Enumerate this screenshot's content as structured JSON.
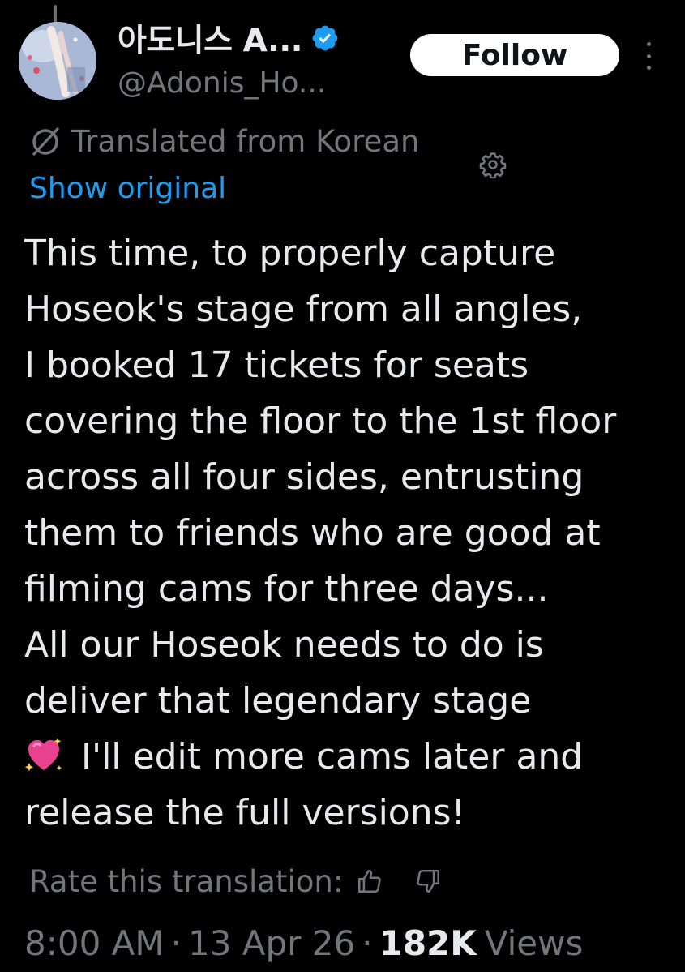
{
  "author": {
    "display_name": "아도니스 A...",
    "handle": "@Adonis_Ho...",
    "verified": true,
    "verified_color": "#1d9bf0"
  },
  "actions": {
    "follow_label": "Follow",
    "more_icon": "more-vertical-icon"
  },
  "translation": {
    "label": "Translated from Korean",
    "show_original": "Show original",
    "icon": "translate-icon",
    "settings_icon": "gear-icon"
  },
  "tweet": {
    "lines": [
      "This time, to properly capture",
      "Hoseok's stage from all angles,",
      "I booked 17 tickets for seats",
      "covering the floor to the 1st floor",
      "across all four sides, entrusting",
      "them to friends who are good at",
      "filming cams for three days...",
      "All our Hoseok needs to do is",
      "deliver that legendary stage",
      "I'll edit more cams later and",
      "release the full versions!"
    ],
    "emoji": "💖"
  },
  "rating": {
    "label": "Rate this translation:",
    "up_icon": "thumbs-up-icon",
    "down_icon": "thumbs-down-icon"
  },
  "meta": {
    "time": "8:00 AM",
    "separator": "·",
    "date": "13 Apr 26",
    "views_count": "182K",
    "views_label": "Views"
  },
  "colors": {
    "background": "#000000",
    "text_primary": "#e7e9ea",
    "text_secondary": "#71767b",
    "link": "#1d9bf0"
  }
}
